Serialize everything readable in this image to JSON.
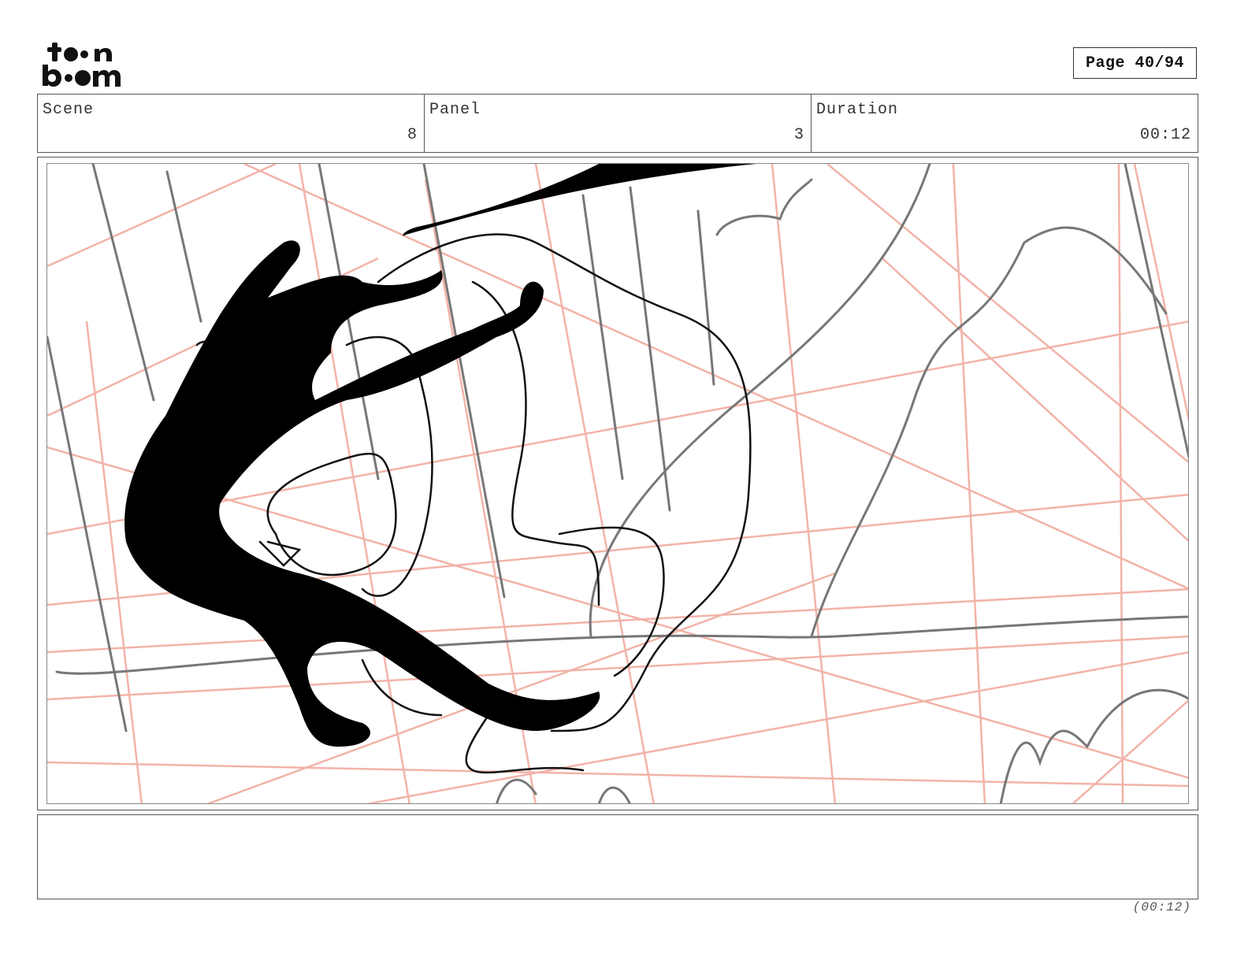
{
  "header": {
    "logo_top": "toon",
    "logo_bottom": "boom",
    "page_label": "Page 40/94"
  },
  "info": {
    "scene_label": "Scene",
    "scene_value": "8",
    "panel_label": "Panel",
    "panel_value": "3",
    "duration_label": "Duration",
    "duration_value": "00:12"
  },
  "panel": {
    "image_description_icon": "storyboard-sketch"
  },
  "notes": {
    "text": ""
  },
  "footer": {
    "duration": "(00:12)"
  }
}
